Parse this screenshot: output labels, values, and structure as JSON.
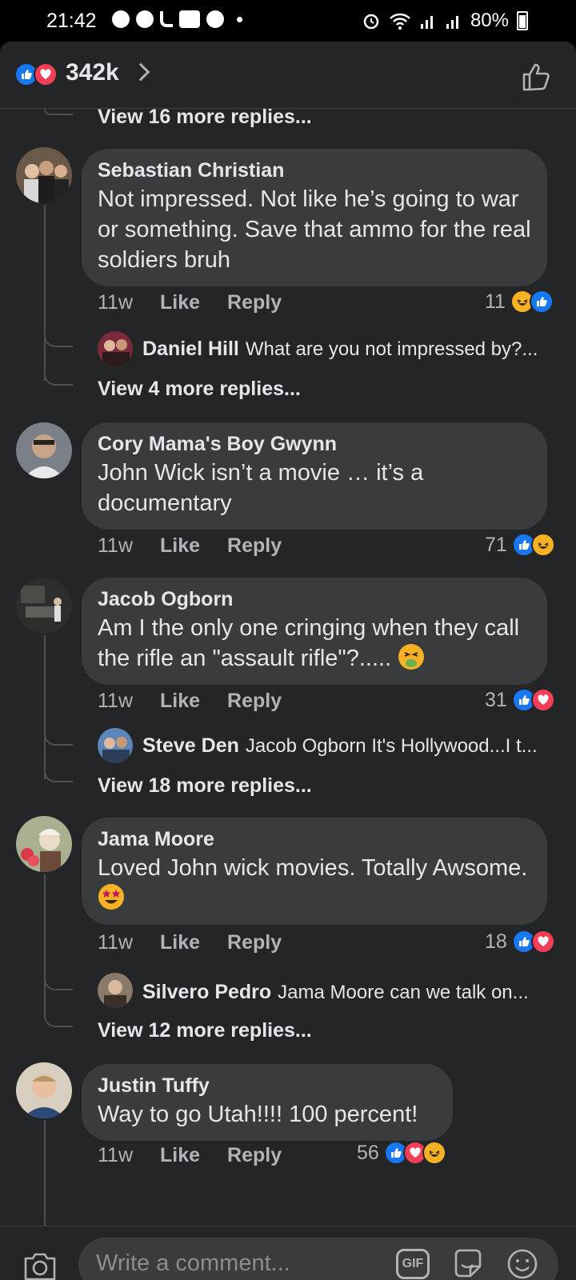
{
  "status_bar": {
    "time": "21:42",
    "battery": "80%"
  },
  "header": {
    "reaction_count": "342k"
  },
  "feed": {
    "top_view_more": "View 16 more replies...",
    "comments": [
      {
        "author": "Sebastian Christian",
        "text": "Not impressed. Not like he’s going to war or something. Save that ammo for the real soldiers bruh",
        "age": "11w",
        "like": "Like",
        "reply": "Reply",
        "reaction_count": "11",
        "reply_preview": {
          "author": "Daniel Hill",
          "text": "What are you not impressed by?..."
        },
        "view_more": "View 4 more replies..."
      },
      {
        "author": "Cory Mama's Boy Gwynn",
        "text": "John Wick isn’t a movie … it’s a documentary",
        "age": "11w",
        "like": "Like",
        "reply": "Reply",
        "reaction_count": "71"
      },
      {
        "author": "Jacob Ogborn",
        "text": "Am I the only one cringing when they call the rifle an \"assault rifle\"?.....",
        "age": "11w",
        "like": "Like",
        "reply": "Reply",
        "reaction_count": "31",
        "reply_preview": {
          "author": "Steve Den",
          "text": "Jacob Ogborn It's Hollywood...I t..."
        },
        "view_more": "View 18 more replies..."
      },
      {
        "author": "Jama Moore",
        "text": "Loved John wick movies. Totally Awsome.",
        "age": "11w",
        "like": "Like",
        "reply": "Reply",
        "reaction_count": "18",
        "reply_preview": {
          "author": "Silvero Pedro",
          "text": "Jama Moore can we talk on..."
        },
        "view_more": "View 12 more replies..."
      },
      {
        "author": "Justin Tuffy",
        "text": "Way to go Utah!!!! 100 percent!",
        "age": "11w",
        "like": "Like",
        "reply": "Reply",
        "reaction_count": "56"
      }
    ]
  },
  "composer": {
    "placeholder": "Write a comment...",
    "gif_label": "GIF"
  },
  "colors": {
    "like_blue": "#1877f2",
    "love_red": "#f33e58",
    "haha_yellow": "#f7b125",
    "bubble_bg": "#3a3b3c",
    "page_bg": "#242526"
  },
  "icons": {
    "header_badges": [
      "like-icon",
      "love-icon"
    ],
    "thumbs_up_outline": "thumbs-up-outline-icon",
    "camera": "camera-icon",
    "sticker": "sticker-icon",
    "emoji": "emoji-icon"
  }
}
